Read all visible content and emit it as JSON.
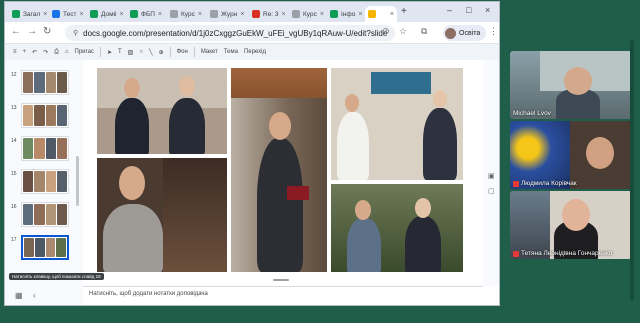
{
  "browser": {
    "tabs": [
      {
        "label": "Загал",
        "color": "#0f9d58"
      },
      {
        "label": "Тест",
        "color": "#1a73e8"
      },
      {
        "label": "Доміі",
        "color": "#0f9d58"
      },
      {
        "label": "ФБП",
        "color": "#0f9d58"
      },
      {
        "label": "Курс",
        "color": "#9aa0a6"
      },
      {
        "label": "Журн",
        "color": "#9aa0a6"
      },
      {
        "label": "Re: 3",
        "color": "#d93025"
      },
      {
        "label": "Курс",
        "color": "#9aa0a6"
      },
      {
        "label": "Інфо",
        "color": "#0f9d58"
      },
      {
        "label": "",
        "color": "#f4b400"
      }
    ],
    "new_tab": "+",
    "url": "docs.google.com/presentation/d/1j0zCxggzGuEkW_uFEi_vgUBy1qRAuw-U/edit?slide=id.p...",
    "profile_label": "Освіта"
  },
  "slide_toolbar": {
    "items": [
      "Пригас",
      "Фон",
      "Макет",
      "Тема",
      "Перехід"
    ]
  },
  "filmstrip": {
    "slide_numbers": [
      "12",
      "13",
      "14",
      "15",
      "16",
      "17"
    ],
    "tooltip": "Натисніть клавішу, щоб показати слайд 18"
  },
  "notes_placeholder": "Натисніть, щоб додати нотатки доповідача",
  "video_tiles": [
    {
      "name": "Michael Lvov",
      "muted": false
    },
    {
      "name": "Людмила Корівчак",
      "muted": true
    },
    {
      "name": "Тетяна Леонідівна Гончаренко",
      "muted": true
    }
  ],
  "colors": {
    "desktop_bg": "#1f5f4a",
    "accent": "#0b57d0",
    "mute_red": "#e53935"
  }
}
